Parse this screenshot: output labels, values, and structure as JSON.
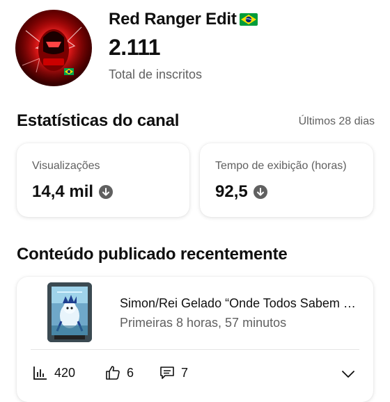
{
  "channel": {
    "name": "Red Ranger Edit",
    "flag_icon": "brazil-flag-icon",
    "subscribers": "2.111",
    "subscribers_label": "Total de inscritos"
  },
  "stats": {
    "title": "Estatísticas do canal",
    "range": "Últimos 28 dias",
    "cards": [
      {
        "label": "Visualizações",
        "value": "14,4 mil",
        "trend_icon": "arrow-down-circle-icon"
      },
      {
        "label": "Tempo de exibição (horas)",
        "value": "92,5",
        "trend_icon": "arrow-down-circle-icon"
      }
    ]
  },
  "recent": {
    "title": "Conteúdo publicado recentemente",
    "video": {
      "title": "Simon/Rei Gelado “Onde Todos Sabem Seu Nome”",
      "meta": "Primeiras 8 horas, 57 minutos",
      "views": "420",
      "likes": "6",
      "comments": "7"
    }
  },
  "colors": {
    "text_primary": "#0f0f0f",
    "text_secondary": "#606060",
    "trend_icon_bg": "#606060"
  }
}
